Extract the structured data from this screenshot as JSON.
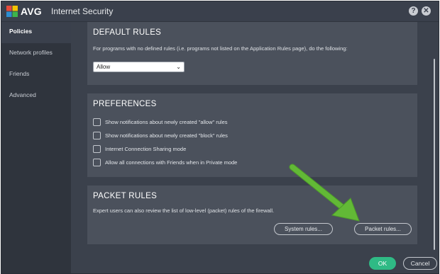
{
  "app": {
    "logo_text": "AVG",
    "title": "Internet Security",
    "help_glyph": "?",
    "close_glyph": "✕"
  },
  "sidebar": {
    "items": [
      {
        "label": "Policies",
        "active": true
      },
      {
        "label": "Network profiles",
        "active": false
      },
      {
        "label": "Friends",
        "active": false
      },
      {
        "label": "Advanced",
        "active": false
      }
    ]
  },
  "default_rules": {
    "heading": "DEFAULT RULES",
    "description": "For programs with no defined rules (i.e. programs not listed on the Application Rules page), do the following:",
    "select_value": "Allow"
  },
  "preferences": {
    "heading": "PREFERENCES",
    "options": [
      {
        "label": "Show notifications about newly created \"allow\" rules",
        "checked": false
      },
      {
        "label": "Show notifications about newly created \"block\" rules",
        "checked": false
      },
      {
        "label": "Internet Connection Sharing mode",
        "checked": false
      },
      {
        "label": "Allow all connections with Friends when in Private mode",
        "checked": false
      }
    ]
  },
  "packet_rules": {
    "heading": "PACKET RULES",
    "description": "Expert users can also review the list of low-level (packet) rules of the firewall.",
    "system_rules_label": "System rules...",
    "packet_rules_label": "Packet rules..."
  },
  "footer": {
    "ok_label": "OK",
    "cancel_label": "Cancel"
  },
  "colors": {
    "accent_green": "#2fba85",
    "arrow_green": "#5cb531",
    "background": "#3a404c",
    "panel": "#4b515c"
  }
}
